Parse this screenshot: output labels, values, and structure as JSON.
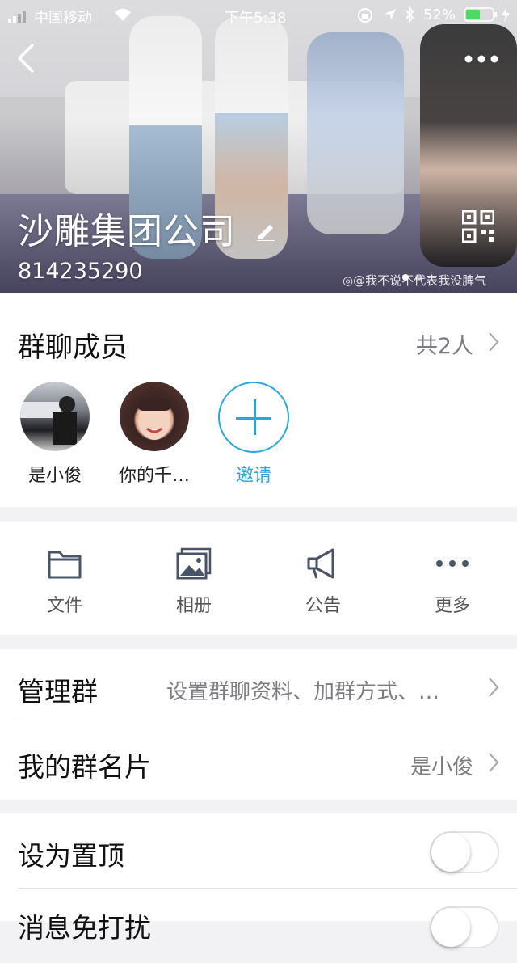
{
  "status": {
    "carrier": "中国移动",
    "time": "下午5:38",
    "battery": "52%"
  },
  "header": {
    "group_name": "沙雕集团公司",
    "group_id": "814235290",
    "watermark": "@我不说不代表我没脾气"
  },
  "members": {
    "title": "群聊成员",
    "count": "共2人",
    "list": [
      {
        "name": "是小俊"
      },
      {
        "name": "你的千…"
      }
    ],
    "invite_label": "邀请"
  },
  "tools": [
    {
      "label": "文件",
      "icon": "folder-icon"
    },
    {
      "label": "相册",
      "icon": "album-icon"
    },
    {
      "label": "公告",
      "icon": "megaphone-icon"
    },
    {
      "label": "更多",
      "icon": "more-dots-icon"
    }
  ],
  "settings": {
    "manage": {
      "label": "管理群",
      "value": "设置群聊资料、加群方式、…"
    },
    "card": {
      "label": "我的群名片",
      "value": "是小俊"
    },
    "pin": {
      "label": "设为置顶",
      "on": false
    },
    "dnd": {
      "label": "消息免打扰",
      "on": false
    }
  },
  "colors": {
    "accent": "#2aa6d8",
    "battery": "#4cd964"
  }
}
